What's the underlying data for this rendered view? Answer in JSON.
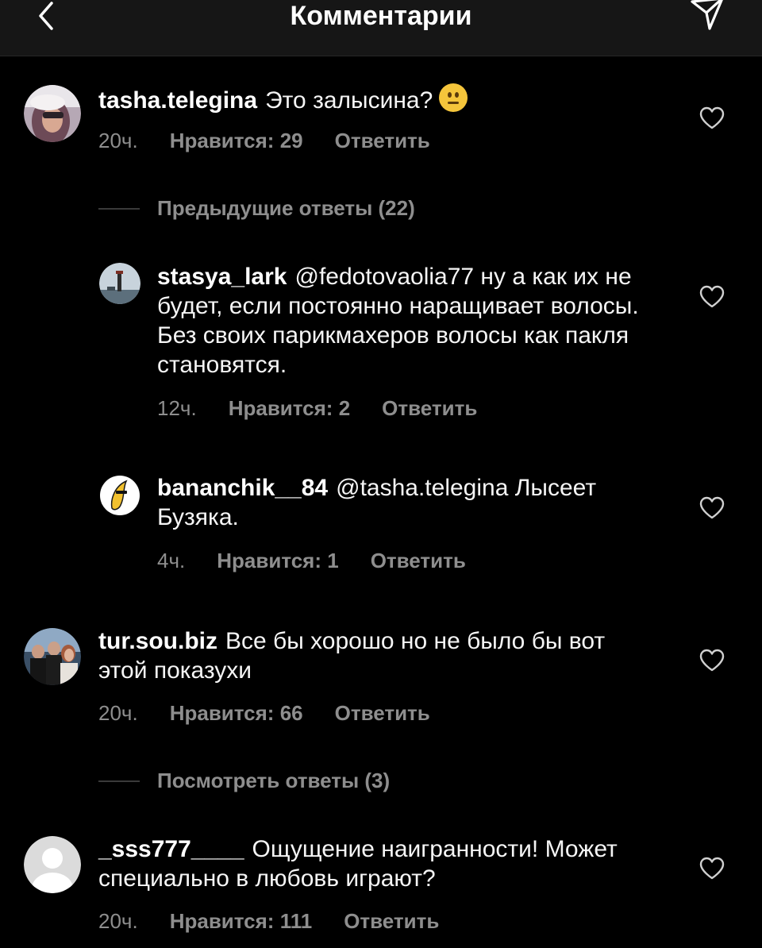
{
  "header": {
    "title": "Комментарии"
  },
  "comments": [
    {
      "username": "tasha.telegina",
      "text": "Это залысина?",
      "emoji": "neutral-face",
      "time": "20ч.",
      "likes": "Нравится: 29",
      "reply": "Ответить",
      "thread": "Предыдущие ответы (22)"
    },
    {
      "username": "stasya_lark",
      "text": "@fedotovaolia77 ну а как их не будет, если постоянно наращивает волосы. Без своих парикмахеров волосы как пакля становятся.",
      "time": "12ч.",
      "likes": "Нравится: 2",
      "reply": "Ответить"
    },
    {
      "username": "bananchik__84",
      "text": "@tasha.telegina Лысеет Бузяка.",
      "time": "4ч.",
      "likes": "Нравится: 1",
      "reply": "Ответить"
    },
    {
      "username": "tur.sou.biz",
      "text": "Все бы хорошо но не было бы вот этой показухи",
      "time": "20ч.",
      "likes": "Нравится: 66",
      "reply": "Ответить",
      "thread": "Посмотреть ответы (3)"
    },
    {
      "username": "_sss777____",
      "text": "Ощущение наигранности! Может специально в любовь играют?",
      "time": "20ч.",
      "likes": "Нравится: 111",
      "reply": "Ответить"
    }
  ],
  "icons": {
    "back": "chevron-left-icon",
    "send": "paper-plane-icon",
    "like": "heart-outline-icon"
  }
}
